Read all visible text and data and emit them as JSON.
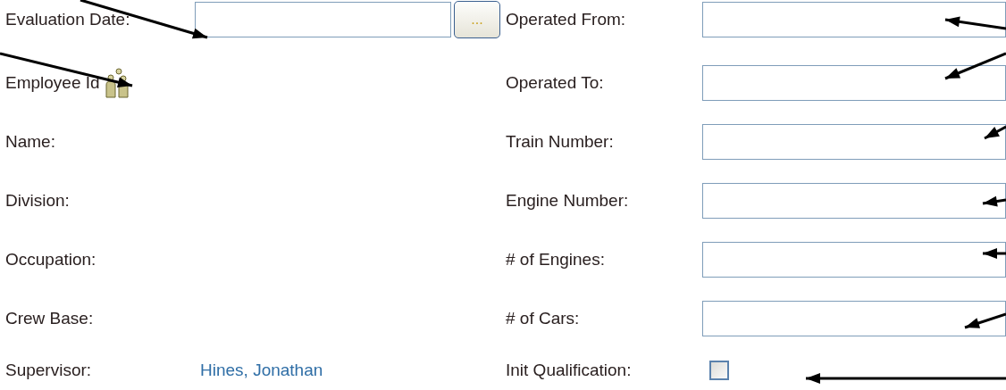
{
  "left_fields": [
    {
      "label": "Evaluation Date:",
      "kind": "date",
      "button": "..."
    },
    {
      "label": "Employee Id",
      "kind": "lookup"
    },
    {
      "label": "Name:",
      "kind": "text"
    },
    {
      "label": "Division:",
      "kind": "text"
    },
    {
      "label": "Occupation:",
      "kind": "text"
    },
    {
      "label": "Crew Base:",
      "kind": "text"
    },
    {
      "label": "Supervisor:",
      "kind": "link",
      "value": "Hines, Jonathan"
    }
  ],
  "right_fields": [
    {
      "label": "Operated From:",
      "kind": "input"
    },
    {
      "label": "Operated To:",
      "kind": "input"
    },
    {
      "label": "Train Number:",
      "kind": "input"
    },
    {
      "label": "Engine Number:",
      "kind": "input"
    },
    {
      "label": "# of Engines:",
      "kind": "input"
    },
    {
      "label": "# of Cars:",
      "kind": "input"
    },
    {
      "label": "Init Qualification:",
      "kind": "checkbox",
      "checked": false
    }
  ]
}
